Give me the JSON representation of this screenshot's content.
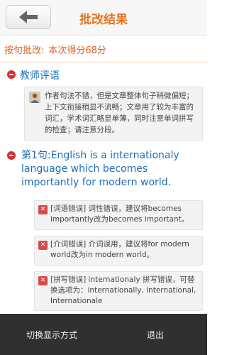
{
  "header": {
    "title": "批改结果",
    "back_icon": "back-arrow-icon"
  },
  "score": {
    "label": "按句批改:",
    "value": "本次得分68分"
  },
  "teacher_comment": {
    "heading": "教师评语",
    "text": "作者句法不错，但是文章整体句子稍微偏短；上下文衔接稍显不流畅；文章用了较为丰富的词汇，学术词汇略显单薄，同时注意单词拼写的检查；请注意分段。"
  },
  "sentence": {
    "heading": "第1句:English is a internationaly language which becomes importantly for modern world."
  },
  "errors": [
    {
      "text": "[词语错误] 词性错误，建议将becomes importantly改为becomes important。"
    },
    {
      "text": "[介词错误] 介词误用，建议将for modern world改为in modern world。"
    },
    {
      "text": "[拼写错误] internationaly 拼写错误，可替换选项为：internationally, international, Internationale"
    }
  ],
  "bottom_bar": {
    "switch_label": "切换显示方式",
    "exit_label": "退出"
  },
  "colors": {
    "accent_orange": "#e8711e",
    "heading_blue": "#1e6fb8",
    "bullet_red": "#d32f2f"
  }
}
